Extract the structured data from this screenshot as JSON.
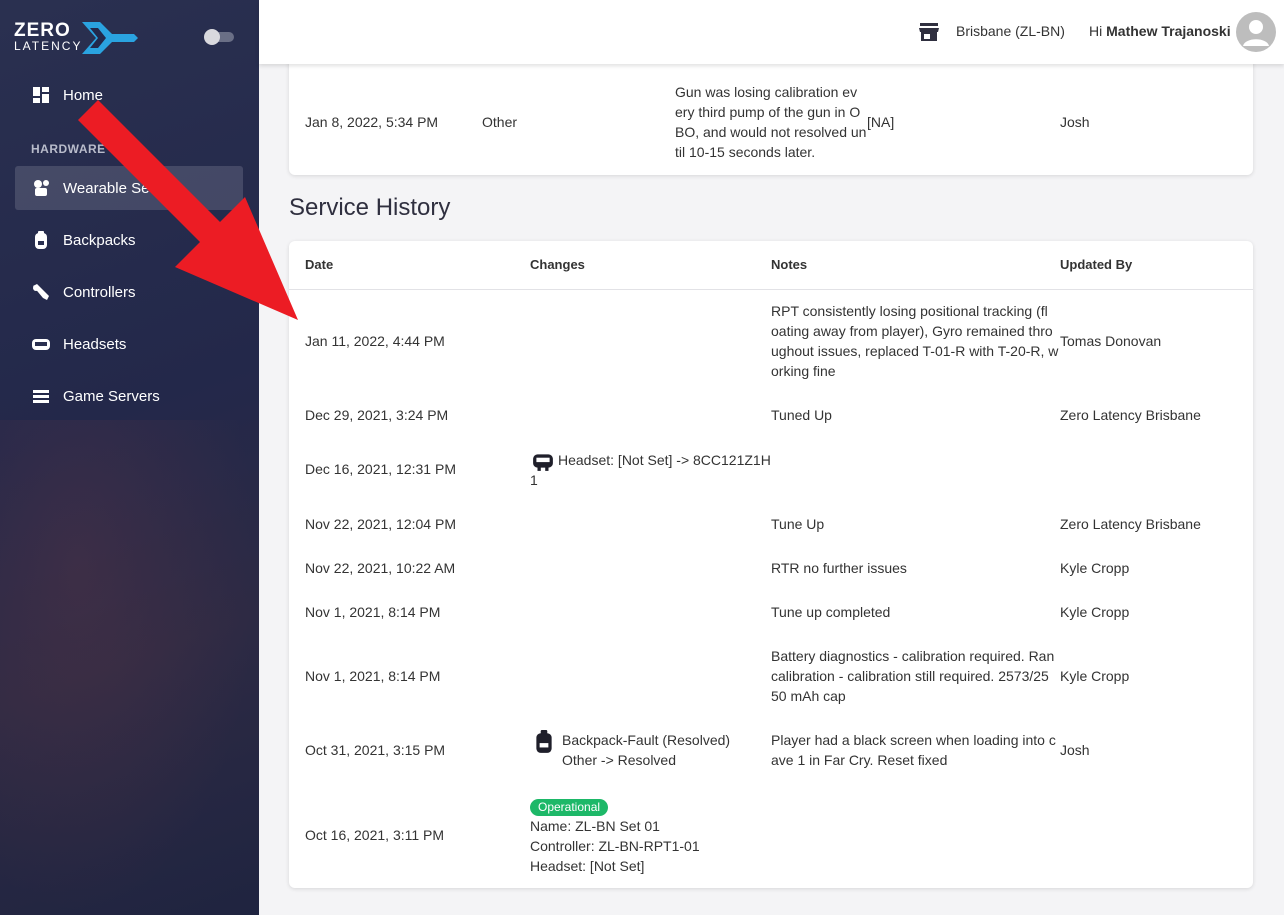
{
  "sidebar": {
    "logo_line1": "ZERO",
    "logo_line2": "LATENCY",
    "section_label": "HARDWARE",
    "items": [
      {
        "label": "Home",
        "icon": "dashboard-icon"
      },
      {
        "label": "Wearable Sets",
        "icon": "wearable-icon"
      },
      {
        "label": "Backpacks",
        "icon": "backpack-icon"
      },
      {
        "label": "Controllers",
        "icon": "controller-icon"
      },
      {
        "label": "Headsets",
        "icon": "headset-icon"
      },
      {
        "label": "Game Servers",
        "icon": "server-icon"
      }
    ]
  },
  "header": {
    "location": "Brisbane (ZL-BN)",
    "greeting": "Hi",
    "user": "Mathew Trajanoski"
  },
  "top_card_row": {
    "date": "Jan 8, 2022, 5:34 PM",
    "type": "Other",
    "description": [
      "Gun was losing calibration ev",
      "ery third pump of the gun in O",
      "BO, and would not resolved un",
      "til 10-15 seconds later."
    ],
    "resolution": "[NA]",
    "user": "Josh"
  },
  "service_history": {
    "title": "Service History",
    "columns": [
      "Date",
      "Changes",
      "Notes",
      "Updated By"
    ],
    "rows": [
      {
        "date": "Jan 11, 2022, 4:44 PM",
        "notes": [
          "RPT consistently losing positional tracking (fl",
          "oating away from player), Gyro remained thro",
          "ughout issues, replaced T-01-R with T-20-R, w",
          "orking fine"
        ],
        "updated_by": "Tomas Donovan"
      },
      {
        "date": "Dec 29, 2021, 3:24 PM",
        "notes": [
          "Tuned Up"
        ],
        "updated_by": "Zero Latency Brisbane"
      },
      {
        "date": "Dec 16, 2021, 12:31 PM",
        "changes": [
          "Headset: [Not Set] -> 8CC121Z1H",
          "1"
        ],
        "notes": [],
        "updated_by": ""
      },
      {
        "date": "Nov 22, 2021, 12:04 PM",
        "notes": [
          "Tune Up"
        ],
        "updated_by": "Zero Latency Brisbane"
      },
      {
        "date": "Nov 22, 2021, 10:22 AM",
        "notes": [
          "RTR no further issues"
        ],
        "updated_by": "Kyle Cropp"
      },
      {
        "date": "Nov 1, 2021, 8:14 PM",
        "notes": [
          "Tune up completed"
        ],
        "updated_by": "Kyle Cropp"
      },
      {
        "date": "Nov 1, 2021, 8:14 PM",
        "notes": [
          "Battery diagnostics - calibration required. Ran",
          "calibration - calibration still required. 2573/25",
          "50 mAh cap"
        ],
        "updated_by": "Kyle Cropp"
      },
      {
        "date": "Oct 31, 2021, 3:15 PM",
        "changes": [
          "Backpack-Fault (Resolved)",
          "Other -> Resolved"
        ],
        "notes": [
          "Player had a black screen when loading into c",
          "ave 1 in Far Cry. Reset fixed"
        ],
        "updated_by": "Josh"
      },
      {
        "date": "Oct 16, 2021, 3:11 PM",
        "badge": "Operational",
        "changes": [
          "Name: ZL-BN Set 01",
          "Controller: ZL-BN-RPT1-01",
          "Headset: [Not Set]"
        ],
        "notes": [],
        "updated_by": ""
      }
    ]
  },
  "colors": {
    "sidebar": "#23284a",
    "badge": "#1db868",
    "arrow": "#ec1c24"
  }
}
